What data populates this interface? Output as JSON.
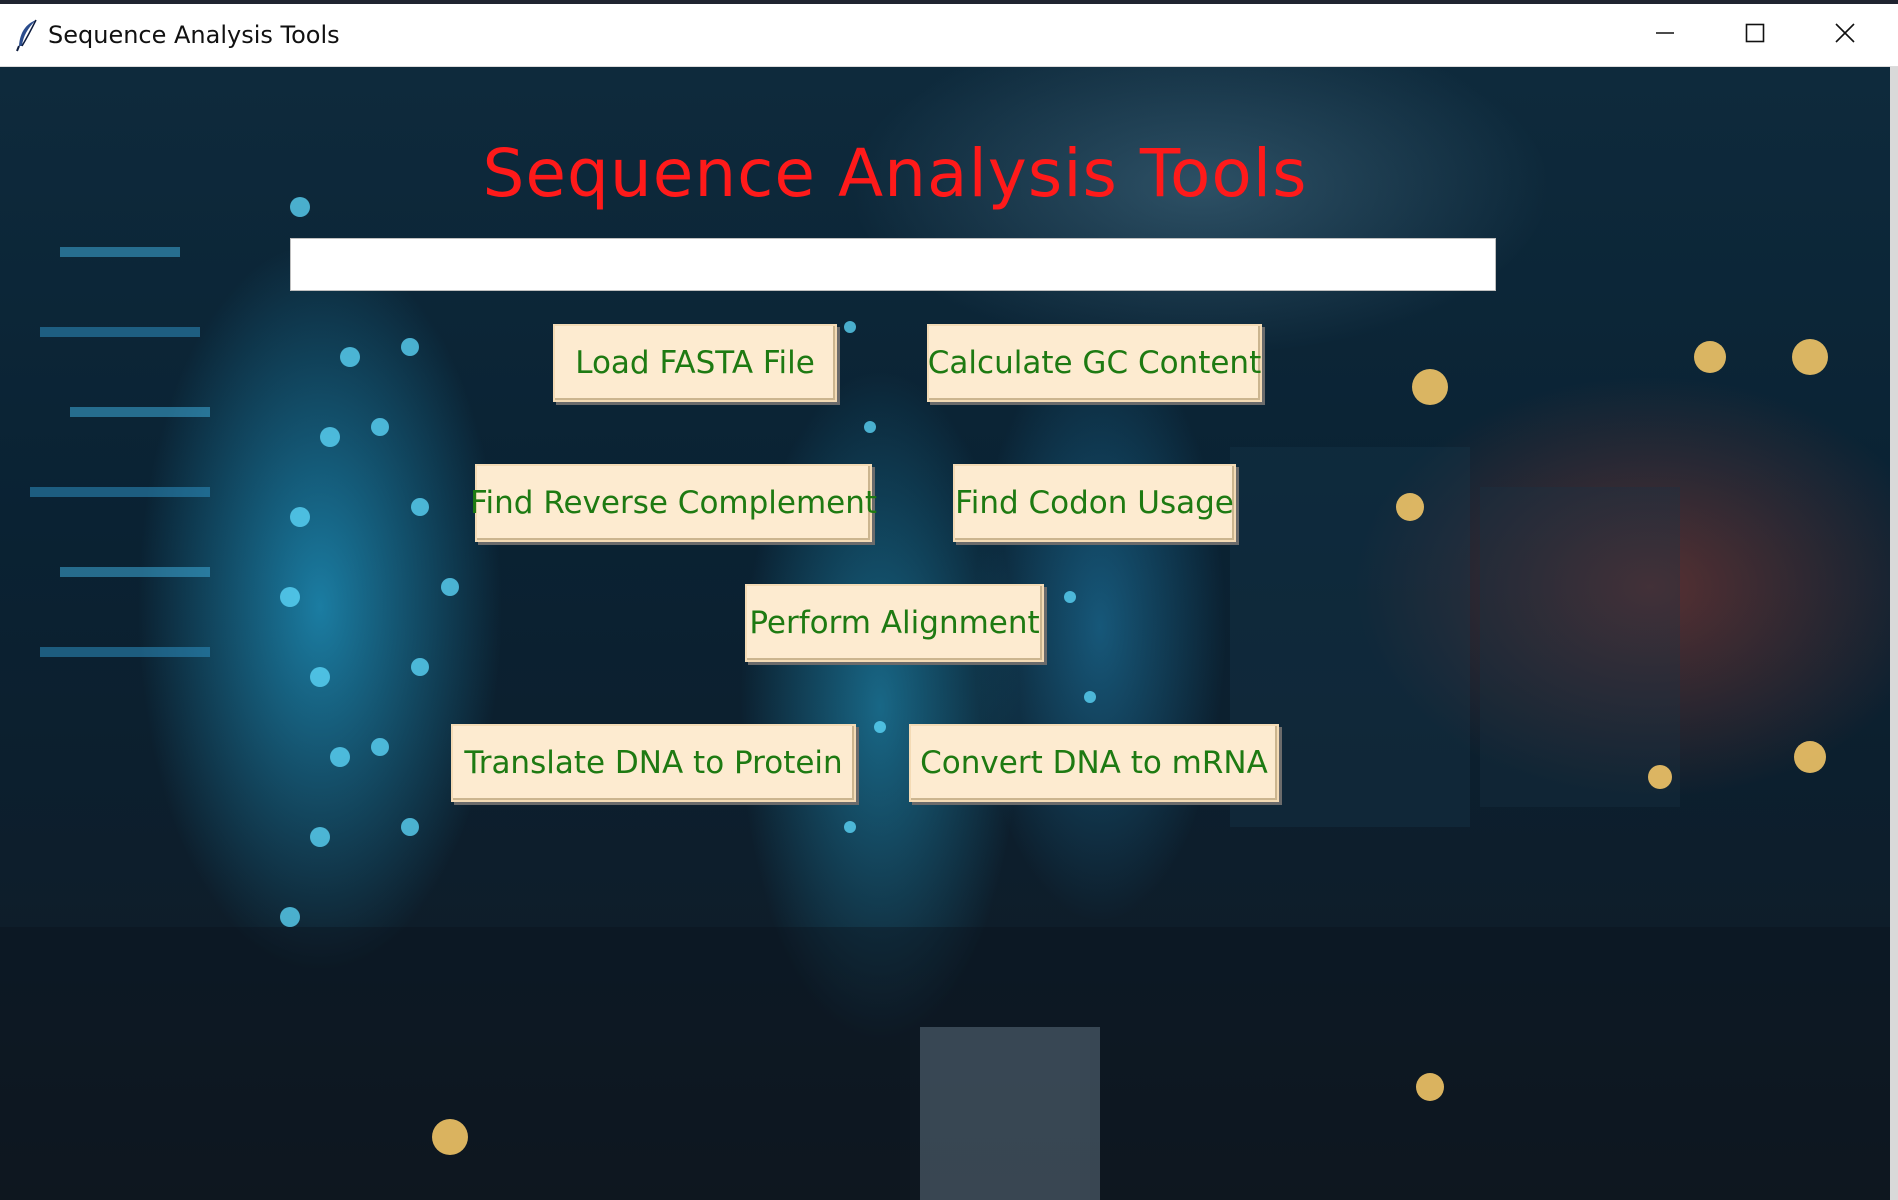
{
  "window": {
    "title": "Sequence Analysis Tools"
  },
  "app": {
    "heading": "Sequence Analysis Tools",
    "sequence_input": {
      "value": "",
      "placeholder": ""
    },
    "buttons": {
      "load_fasta": "Load FASTA File",
      "gc_content": "Calculate GC Content",
      "reverse_complement": "Find Reverse Complement",
      "codon_usage": "Find Codon Usage",
      "alignment": "Perform Alignment",
      "translate": "Translate DNA to Protein",
      "mrna": "Convert DNA to mRNA"
    }
  },
  "colors": {
    "heading": "#ff1a1a",
    "button_bg": "#fdebd0",
    "button_text": "#1e7a12"
  },
  "icons": {
    "app": "feather-icon",
    "minimize": "minimize-icon",
    "maximize": "maximize-icon",
    "close": "close-icon"
  }
}
